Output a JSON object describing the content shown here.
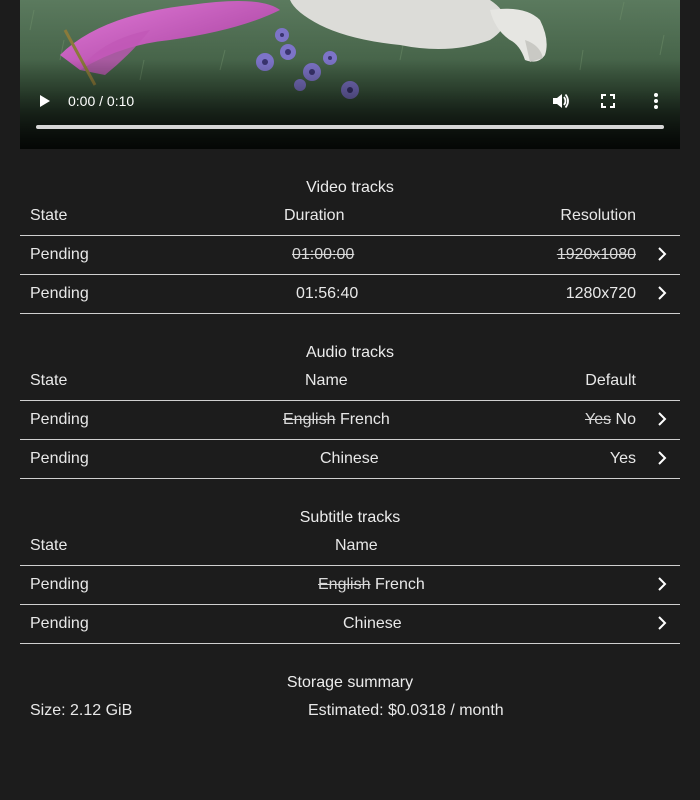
{
  "player": {
    "time": "0:00 / 0:10",
    "play_icon": "play-icon",
    "volume_icon": "volume-icon",
    "fullscreen_icon": "fullscreen-icon",
    "more_icon": "more-vert-icon",
    "progress": 0
  },
  "video_tracks": {
    "caption": "Video tracks",
    "headers": {
      "state": "State",
      "duration": "Duration",
      "resolution": "Resolution"
    },
    "rows": [
      {
        "state": "Pending",
        "duration_old": "01:00:00",
        "resolution_old": "1920x1080"
      },
      {
        "state": "Pending",
        "duration": "01:56:40",
        "resolution": "1280x720"
      }
    ]
  },
  "audio_tracks": {
    "caption": "Audio tracks",
    "headers": {
      "state": "State",
      "name": "Name",
      "default": "Default"
    },
    "rows": [
      {
        "state": "Pending",
        "name_old": "English",
        "name_new": "French",
        "default_old": "Yes",
        "default_new": "No"
      },
      {
        "state": "Pending",
        "name": "Chinese",
        "default": "Yes"
      }
    ]
  },
  "subtitle_tracks": {
    "caption": "Subtitle tracks",
    "headers": {
      "state": "State",
      "name": "Name"
    },
    "rows": [
      {
        "state": "Pending",
        "name_old": "English",
        "name_new": "French"
      },
      {
        "state": "Pending",
        "name": "Chinese"
      }
    ]
  },
  "storage": {
    "caption": "Storage summary",
    "size": "Size: 2.12 GiB",
    "estimated": "Estimated: $0.0318 / month"
  }
}
